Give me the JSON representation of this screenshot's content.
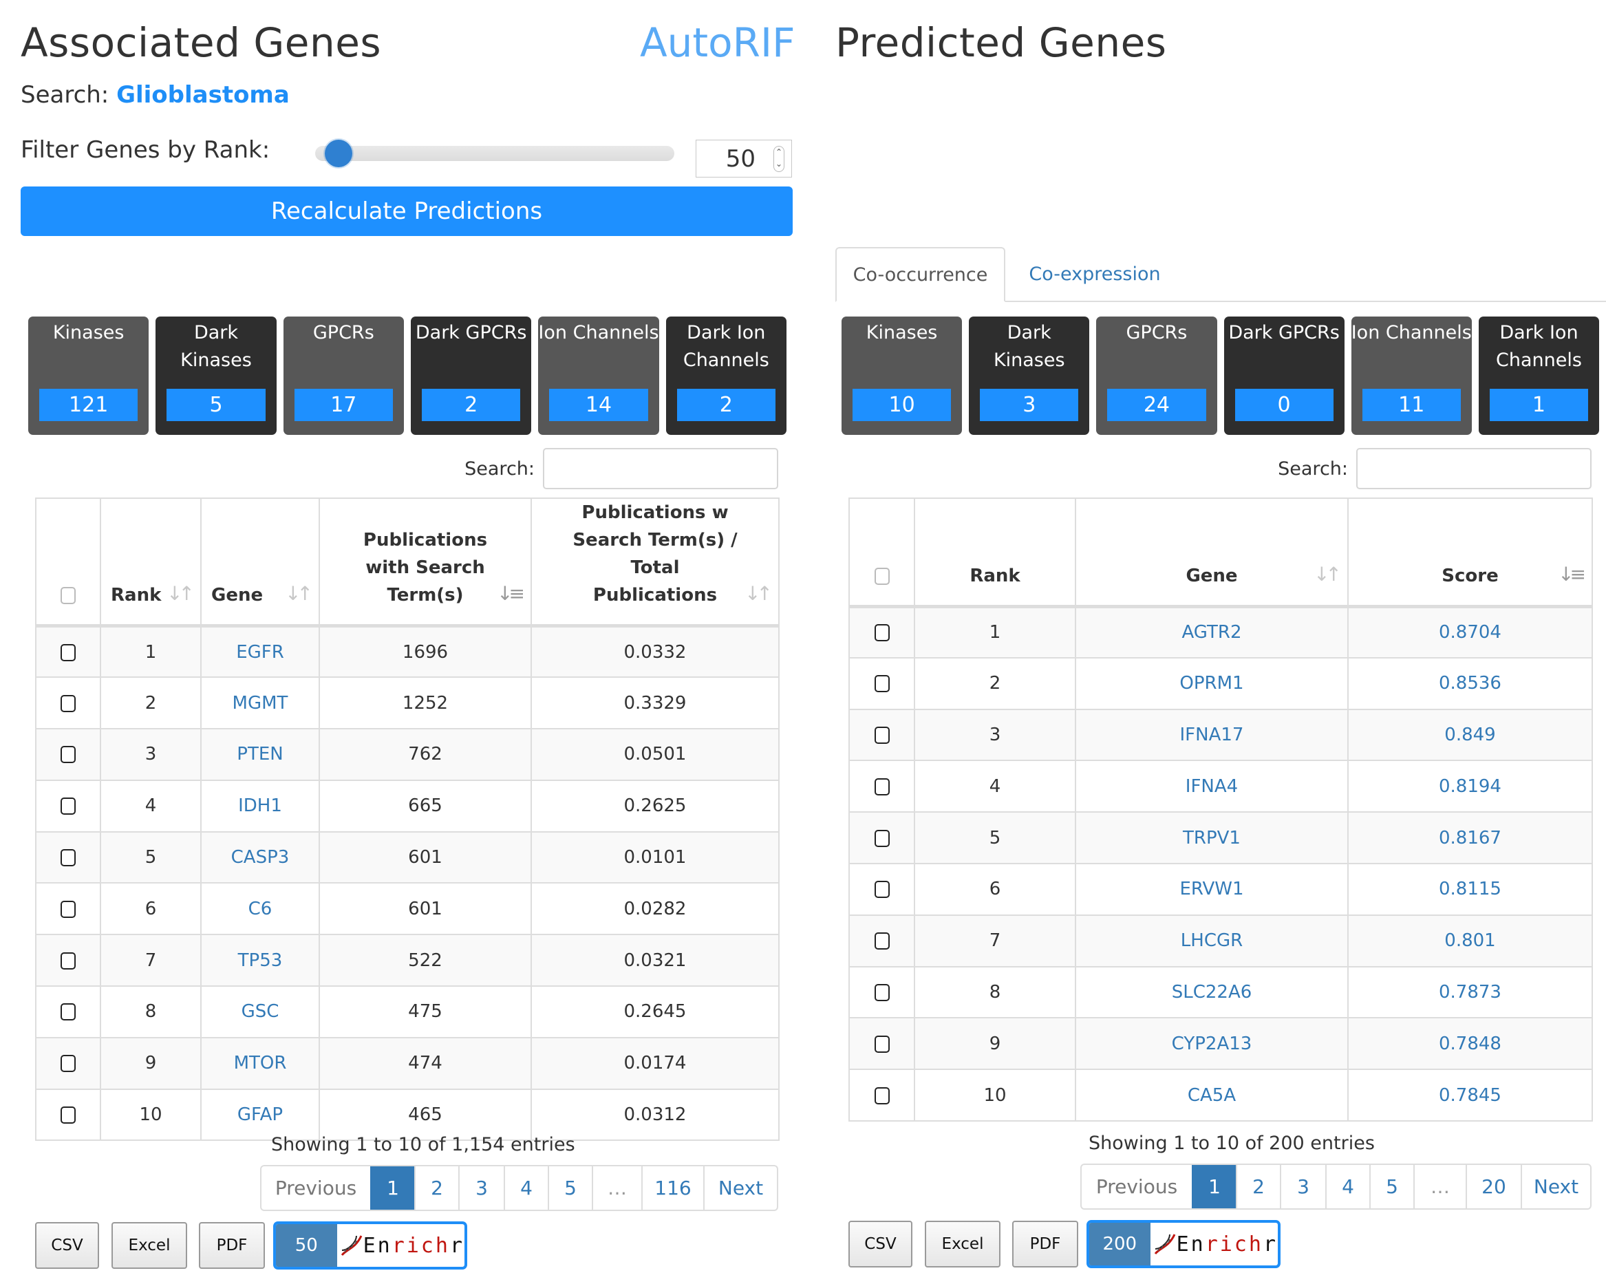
{
  "associated": {
    "title": "Associated Genes",
    "brand": "AutoRIF",
    "search_label": "Search:",
    "search_term": "Glioblastoma",
    "filter_label": "Filter Genes by Rank:",
    "filter_value": "50",
    "slider_fraction": 0.03,
    "recalc_label": "Recalculate Predictions",
    "categories": [
      {
        "label": "Kinases",
        "count": "121",
        "style": "light"
      },
      {
        "label": "Dark Kinases",
        "count": "5",
        "style": "dark"
      },
      {
        "label": "GPCRs",
        "count": "17",
        "style": "light"
      },
      {
        "label": "Dark GPCRs",
        "count": "2",
        "style": "dark"
      },
      {
        "label": "Ion Channels",
        "count": "14",
        "style": "light"
      },
      {
        "label": "Dark Ion Channels",
        "count": "2",
        "style": "dark"
      }
    ],
    "table_search_label": "Search:",
    "table_search_value": "",
    "columns": [
      "",
      "Rank",
      "Gene",
      "Publications with Search Term(s)",
      "Publications w Search Term(s) / Total Publications"
    ],
    "rows": [
      {
        "rank": "1",
        "gene": "EGFR",
        "pubs": "1696",
        "ratio": "0.0332"
      },
      {
        "rank": "2",
        "gene": "MGMT",
        "pubs": "1252",
        "ratio": "0.3329"
      },
      {
        "rank": "3",
        "gene": "PTEN",
        "pubs": "762",
        "ratio": "0.0501"
      },
      {
        "rank": "4",
        "gene": "IDH1",
        "pubs": "665",
        "ratio": "0.2625"
      },
      {
        "rank": "5",
        "gene": "CASP3",
        "pubs": "601",
        "ratio": "0.0101"
      },
      {
        "rank": "6",
        "gene": "C6",
        "pubs": "601",
        "ratio": "0.0282"
      },
      {
        "rank": "7",
        "gene": "TP53",
        "pubs": "522",
        "ratio": "0.0321"
      },
      {
        "rank": "8",
        "gene": "GSC",
        "pubs": "475",
        "ratio": "0.2645"
      },
      {
        "rank": "9",
        "gene": "MTOR",
        "pubs": "474",
        "ratio": "0.0174"
      },
      {
        "rank": "10",
        "gene": "GFAP",
        "pubs": "465",
        "ratio": "0.0312"
      }
    ],
    "info": "Showing 1 to 10 of 1,154 entries",
    "pagination": [
      "Previous",
      "1",
      "2",
      "3",
      "4",
      "5",
      "…",
      "116",
      "Next"
    ],
    "current_page": "1",
    "export": {
      "csv": "CSV",
      "excel": "Excel",
      "pdf": "PDF"
    },
    "enrichr_count": "50",
    "enrichr_label": {
      "a": "En",
      "b": "rich",
      "c": "r"
    }
  },
  "predicted": {
    "title": "Predicted Genes",
    "tabs": [
      {
        "label": "Co-occurrence",
        "active": true
      },
      {
        "label": "Co-expression",
        "active": false
      }
    ],
    "categories": [
      {
        "label": "Kinases",
        "count": "10",
        "style": "light"
      },
      {
        "label": "Dark Kinases",
        "count": "3",
        "style": "dark"
      },
      {
        "label": "GPCRs",
        "count": "24",
        "style": "light"
      },
      {
        "label": "Dark GPCRs",
        "count": "0",
        "style": "dark"
      },
      {
        "label": "Ion Channels",
        "count": "11",
        "style": "light"
      },
      {
        "label": "Dark Ion Channels",
        "count": "1",
        "style": "dark"
      }
    ],
    "table_search_label": "Search:",
    "table_search_value": "",
    "columns": [
      "",
      "Rank",
      "Gene",
      "Score"
    ],
    "rows": [
      {
        "rank": "1",
        "gene": "AGTR2",
        "score": "0.8704"
      },
      {
        "rank": "2",
        "gene": "OPRM1",
        "score": "0.8536"
      },
      {
        "rank": "3",
        "gene": "IFNA17",
        "score": "0.849"
      },
      {
        "rank": "4",
        "gene": "IFNA4",
        "score": "0.8194"
      },
      {
        "rank": "5",
        "gene": "TRPV1",
        "score": "0.8167"
      },
      {
        "rank": "6",
        "gene": "ERVW1",
        "score": "0.8115"
      },
      {
        "rank": "7",
        "gene": "LHCGR",
        "score": "0.801"
      },
      {
        "rank": "8",
        "gene": "SLC22A6",
        "score": "0.7873"
      },
      {
        "rank": "9",
        "gene": "CYP2A13",
        "score": "0.7848"
      },
      {
        "rank": "10",
        "gene": "CA5A",
        "score": "0.7845"
      }
    ],
    "info": "Showing 1 to 10 of 200 entries",
    "pagination": [
      "Previous",
      "1",
      "2",
      "3",
      "4",
      "5",
      "…",
      "20",
      "Next"
    ],
    "current_page": "1",
    "export": {
      "csv": "CSV",
      "excel": "Excel",
      "pdf": "PDF"
    },
    "enrichr_count": "200",
    "enrichr_label": {
      "a": "En",
      "b": "rich",
      "c": "r"
    }
  },
  "colors": {
    "accent": "#1e90ff",
    "link": "#337ab7",
    "tile_light": "#575757",
    "tile_dark": "#2e2e2e"
  }
}
